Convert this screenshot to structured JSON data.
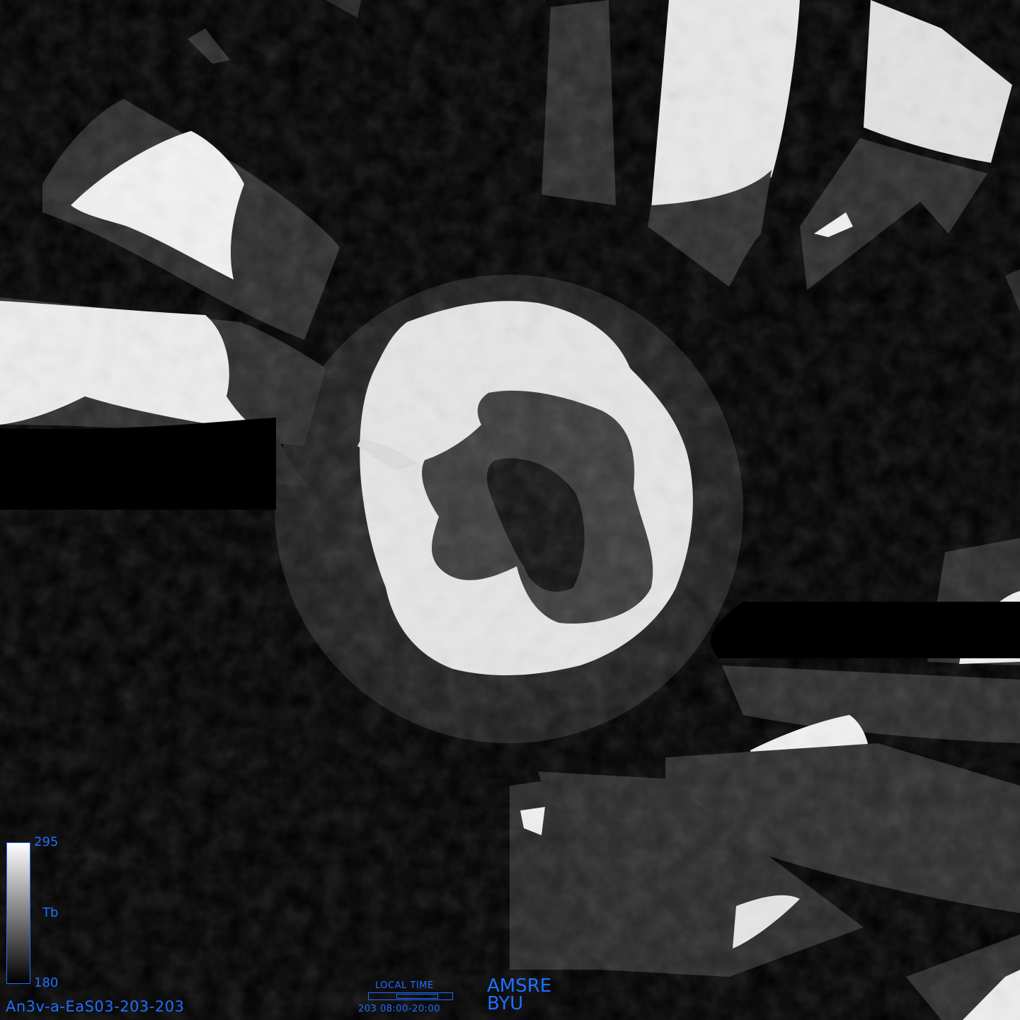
{
  "colorbar": {
    "max": "295",
    "min": "180",
    "unit": "Tb"
  },
  "file_id": "An3v-a-EaS03-203-203",
  "local_time": {
    "title": "LOCAL TIME",
    "range": "203 08:00-20:00",
    "day_fraction_start": 0.333,
    "day_fraction_end": 0.833
  },
  "sensor": {
    "name": "AMSRE",
    "institution": "BYU"
  },
  "colors": {
    "label_blue": "#1f6fff"
  }
}
